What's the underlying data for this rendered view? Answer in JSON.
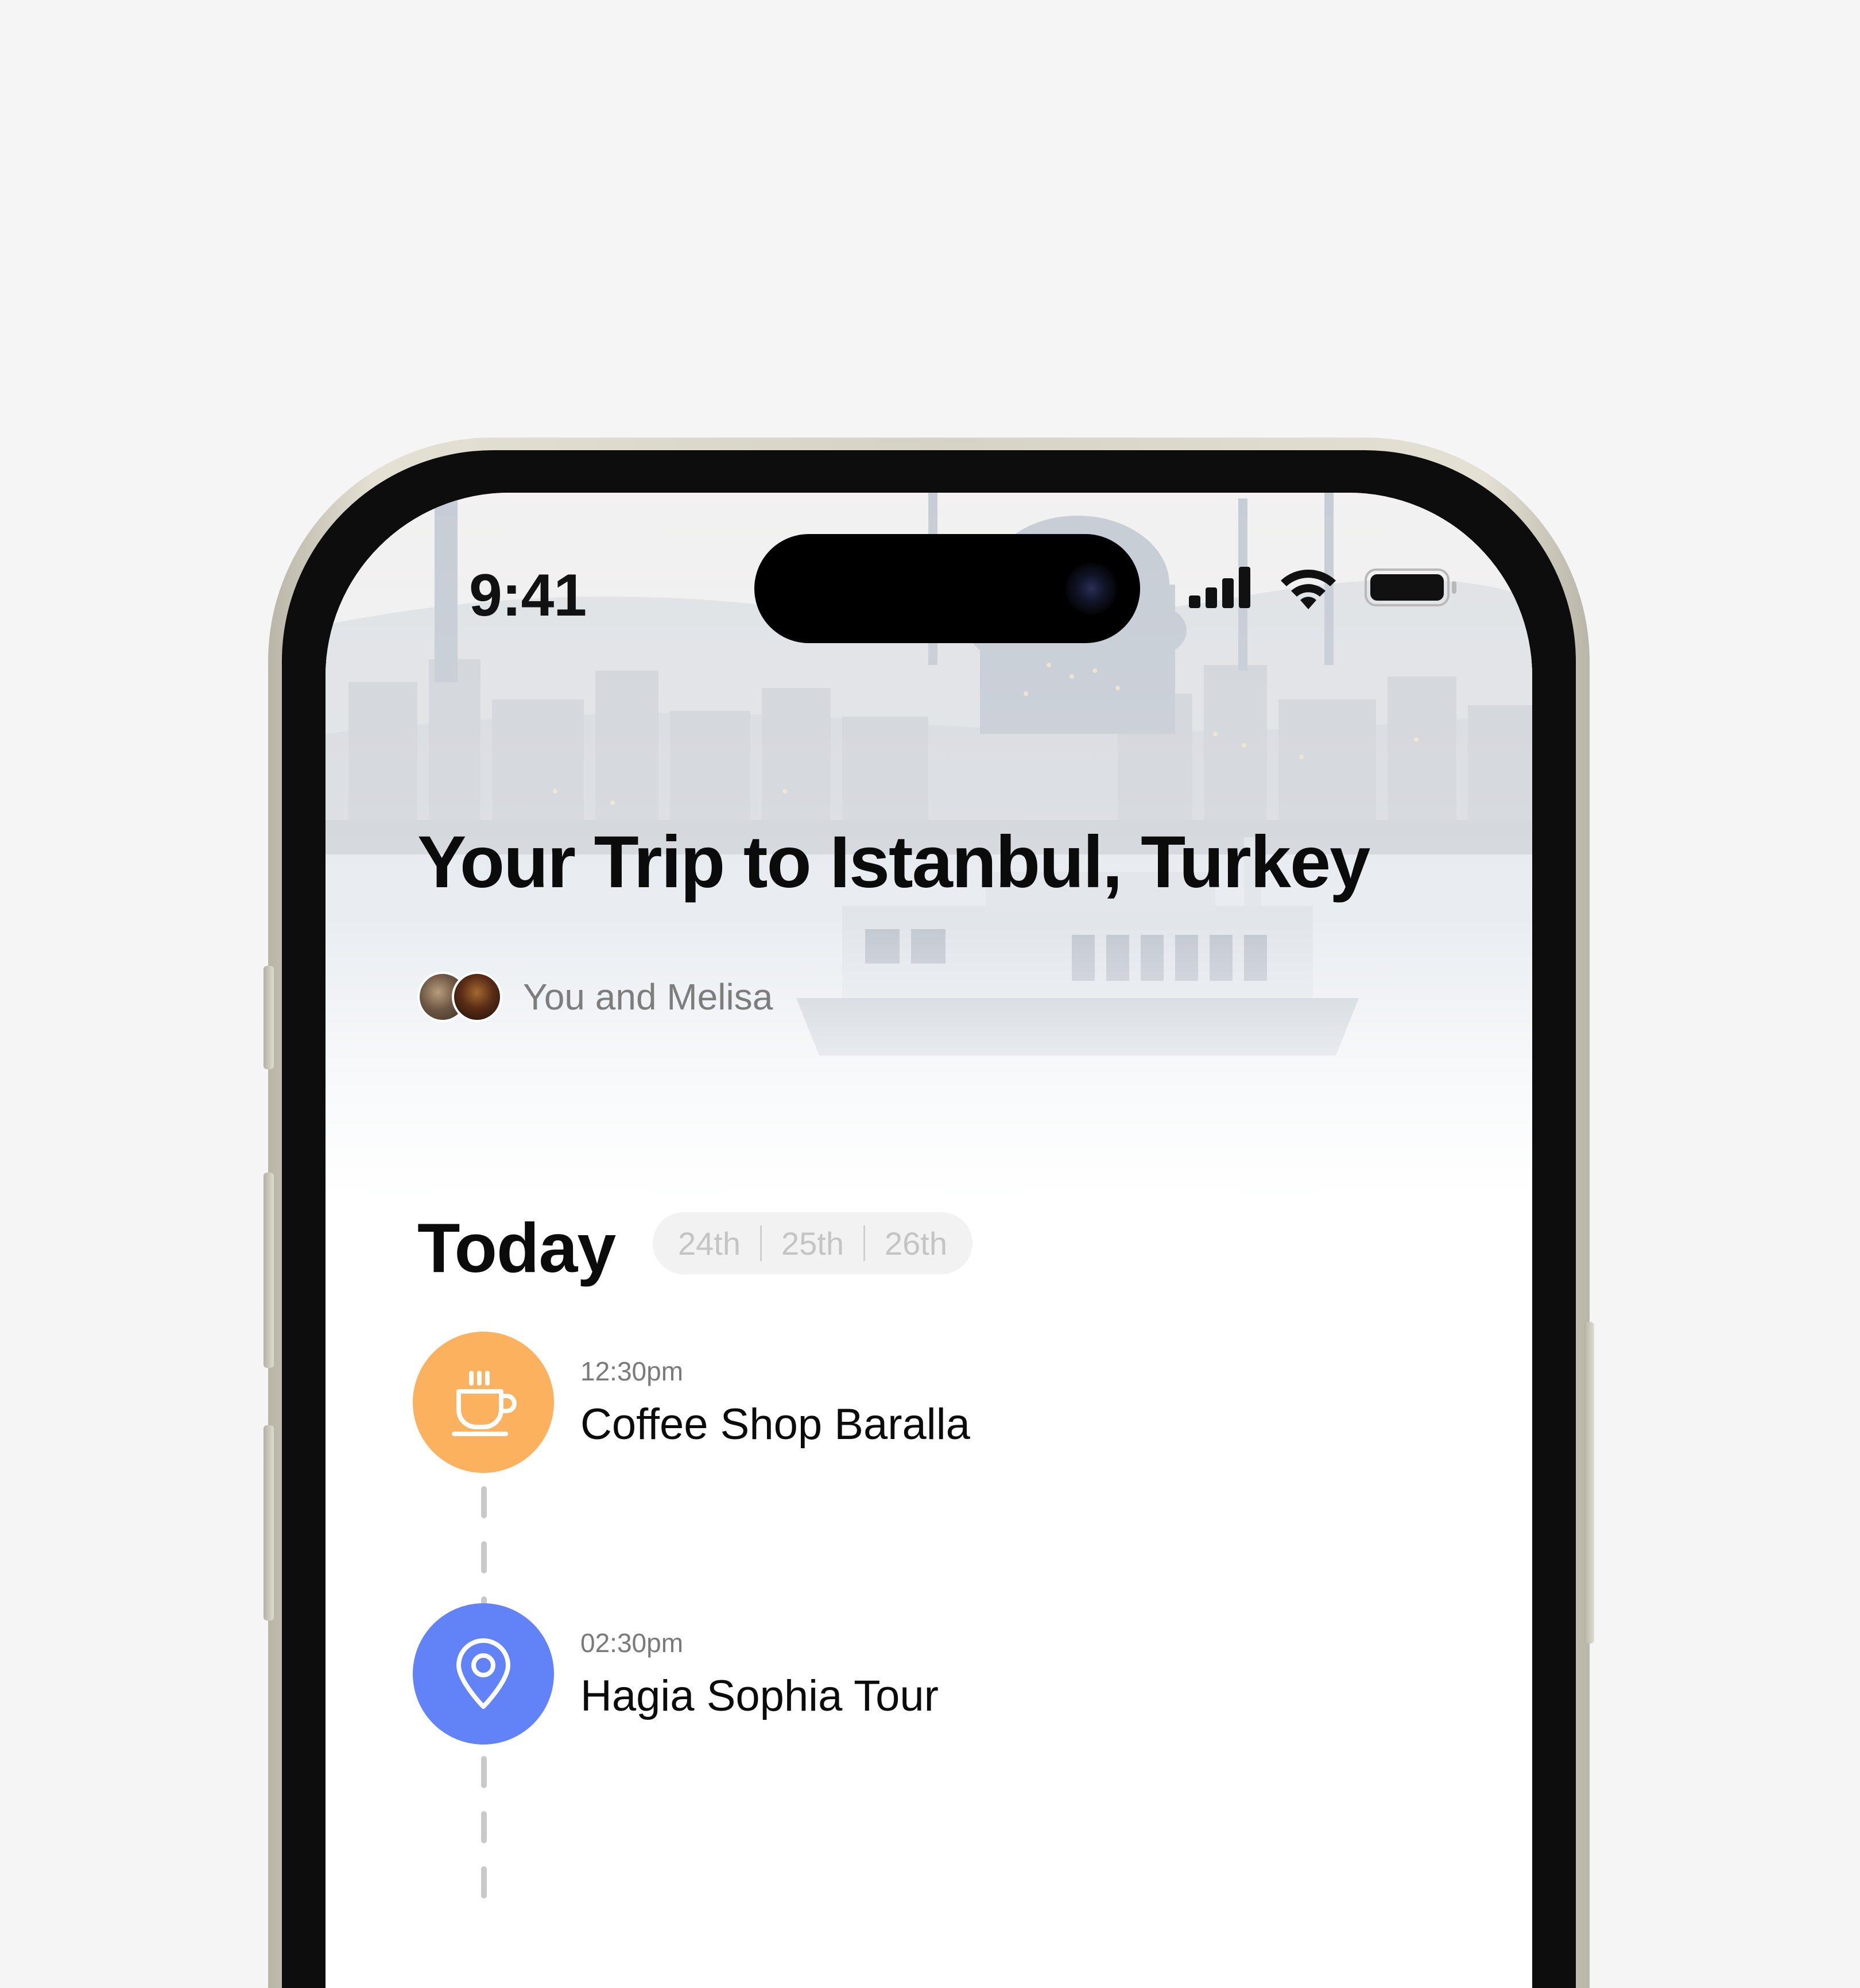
{
  "status_bar": {
    "time": "9:41",
    "icons": [
      "cellular-signal-icon",
      "wifi-icon",
      "battery-icon"
    ]
  },
  "trip": {
    "title": "Your Trip to Istanbul, Turkey",
    "companions_label": "You and Melisa"
  },
  "schedule": {
    "heading": "Today",
    "days": [
      "24th",
      "25th",
      "26th"
    ],
    "events": [
      {
        "time": "12:30pm",
        "name": "Coffee Shop Baralla",
        "icon": "coffee-cup-icon",
        "color": "#FBB15E"
      },
      {
        "time": "02:30pm",
        "name": "Hagia Sophia Tour",
        "icon": "map-pin-icon",
        "color": "#6282F7"
      }
    ]
  },
  "colors": {
    "background": "#F5F5F5",
    "frame": "#D6D3C6",
    "coffee_accent": "#FBB15E",
    "tour_accent": "#6282F7",
    "pill_bg": "#F2F2F2"
  }
}
